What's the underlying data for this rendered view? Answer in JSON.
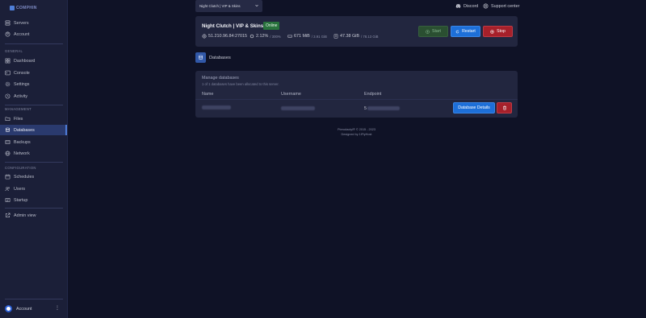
{
  "sidebar": {
    "logo_text": "COMPHIN",
    "top_items": [
      {
        "label": "Servers",
        "icon": "server-icon"
      },
      {
        "label": "Account",
        "icon": "account-icon"
      }
    ],
    "general_label": "GENERAL",
    "general_items": [
      {
        "label": "Dashboard",
        "icon": "dashboard-icon"
      },
      {
        "label": "Console",
        "icon": "console-icon"
      },
      {
        "label": "Settings",
        "icon": "settings-icon"
      },
      {
        "label": "Activity",
        "icon": "activity-icon"
      }
    ],
    "management_label": "MANAGEMENT",
    "management_items": [
      {
        "label": "Files",
        "icon": "files-icon"
      },
      {
        "label": "Databases",
        "icon": "database-icon",
        "active": true
      },
      {
        "label": "Backups",
        "icon": "backups-icon"
      },
      {
        "label": "Network",
        "icon": "network-icon"
      }
    ],
    "configuration_label": "CONFIGURATION",
    "configuration_items": [
      {
        "label": "Schedules",
        "icon": "schedules-icon"
      },
      {
        "label": "Users",
        "icon": "users-icon"
      },
      {
        "label": "Startup",
        "icon": "startup-icon"
      }
    ],
    "admin_view": "Admin view",
    "account_bottom": "Account"
  },
  "topbar": {
    "server_select_value": "Night Clutch | VIP & Skins",
    "discord": "Discord",
    "support_center": "Support center"
  },
  "server": {
    "name": "Night Clutch | VIP & Skins",
    "status": "Online",
    "address": "51.210.96.84:27015",
    "cpu": "2.12%",
    "cpu_limit": "/ 300%",
    "memory": "671 MiB",
    "memory_limit": "/ 3.91 GiB",
    "disk": "47.38 GiB",
    "disk_limit": "/ 78.13 GiB",
    "start_label": "Start",
    "restart_label": "Restart",
    "stop_label": "Stop"
  },
  "databases": {
    "title": "Databases",
    "manage_label": "Manage databases",
    "allocation_text": "1 of 1 databases have been allocated to this server.",
    "columns": {
      "name": "Name",
      "username": "Username",
      "endpoint": "Endpoint"
    },
    "endpoint_prefix": "5",
    "details_button": "Database Details"
  },
  "footer": {
    "line1": "Pterodactyl® © 2015 - 2023",
    "line2": "Designed by 1lFlyHost"
  },
  "colors": {
    "background": "#0f1226",
    "sidebar": "#1b1f38",
    "card": "#22263f",
    "accent_blue": "#1d6fd8",
    "online_green": "#28713c",
    "danger_red": "#a6202a"
  }
}
